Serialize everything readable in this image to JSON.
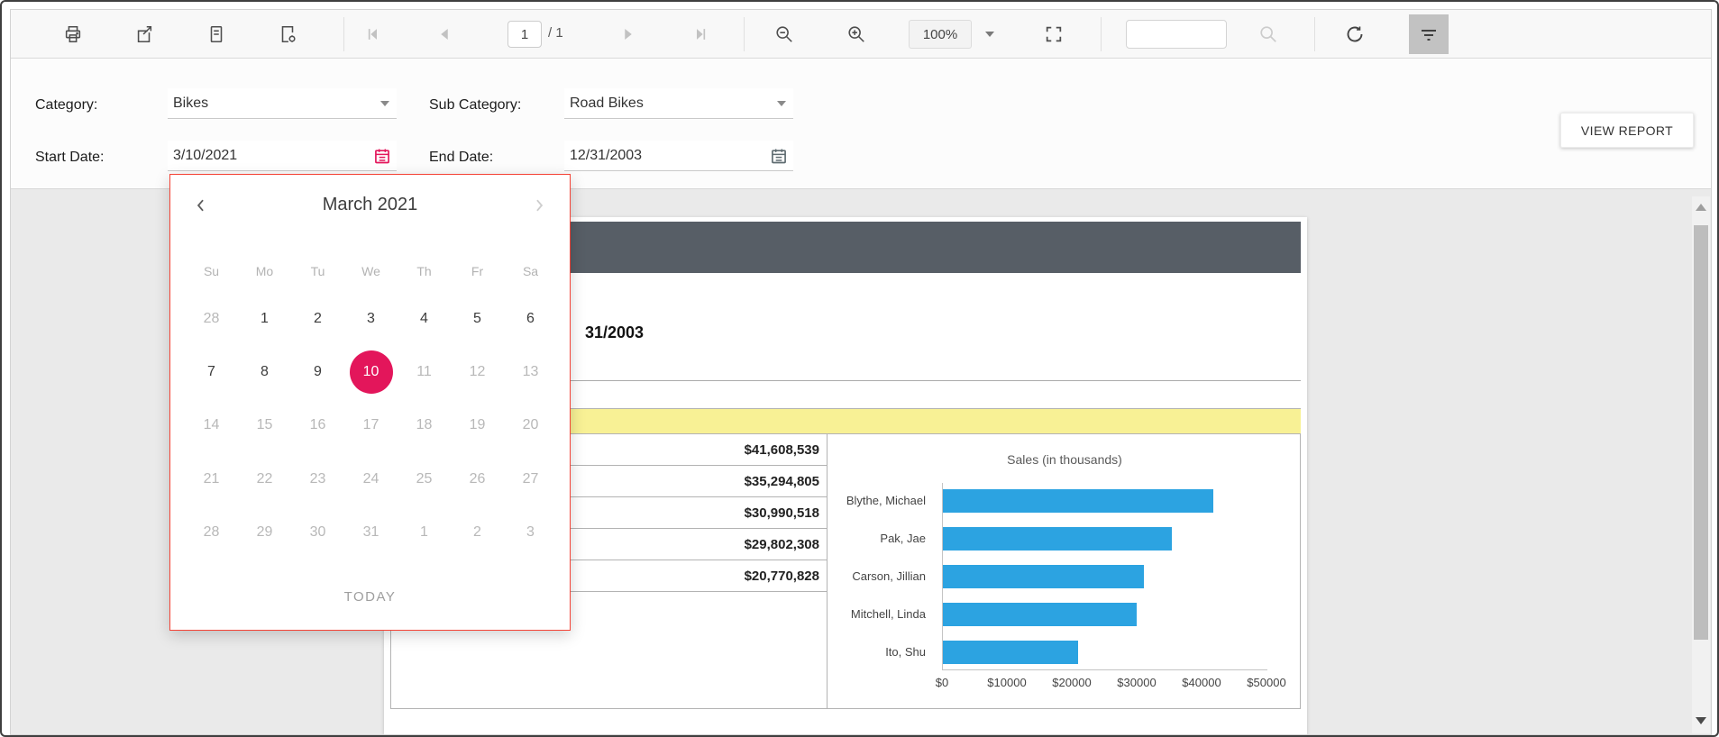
{
  "colors": {
    "accent_pink": "#e3165b",
    "popup_border": "#f44336",
    "bar_blue": "#2ca3e1",
    "header_slate": "#575e66",
    "table_header_yellow": "#f8f195"
  },
  "toolbar": {
    "page_number": "1",
    "page_count_display": "/ 1",
    "zoom_level": "100%",
    "search_value": ""
  },
  "parameters": {
    "category_label": "Category:",
    "category_value": "Bikes",
    "subcategory_label": "Sub Category:",
    "subcategory_value": "Road Bikes",
    "start_date_label": "Start Date:",
    "start_date_value": "3/10/2021",
    "end_date_label": "End Date:",
    "end_date_value": "12/31/2003",
    "view_report_label": "VIEW REPORT"
  },
  "datepicker": {
    "title": "March 2021",
    "day_headers": [
      "Su",
      "Mo",
      "Tu",
      "We",
      "Th",
      "Fr",
      "Sa"
    ],
    "weeks": [
      [
        {
          "d": "28",
          "muted": true
        },
        {
          "d": "1"
        },
        {
          "d": "2"
        },
        {
          "d": "3"
        },
        {
          "d": "4"
        },
        {
          "d": "5"
        },
        {
          "d": "6"
        }
      ],
      [
        {
          "d": "7"
        },
        {
          "d": "8"
        },
        {
          "d": "9"
        },
        {
          "d": "10",
          "selected": true
        },
        {
          "d": "11",
          "muted": true
        },
        {
          "d": "12",
          "muted": true
        },
        {
          "d": "13",
          "muted": true
        }
      ],
      [
        {
          "d": "14",
          "muted": true
        },
        {
          "d": "15",
          "muted": true
        },
        {
          "d": "16",
          "muted": true
        },
        {
          "d": "17",
          "muted": true
        },
        {
          "d": "18",
          "muted": true
        },
        {
          "d": "19",
          "muted": true
        },
        {
          "d": "20",
          "muted": true
        }
      ],
      [
        {
          "d": "21",
          "muted": true
        },
        {
          "d": "22",
          "muted": true
        },
        {
          "d": "23",
          "muted": true
        },
        {
          "d": "24",
          "muted": true
        },
        {
          "d": "25",
          "muted": true
        },
        {
          "d": "26",
          "muted": true
        },
        {
          "d": "27",
          "muted": true
        }
      ],
      [
        {
          "d": "28",
          "muted": true
        },
        {
          "d": "29",
          "muted": true
        },
        {
          "d": "30",
          "muted": true
        },
        {
          "d": "31",
          "muted": true
        },
        {
          "d": "1",
          "muted": true
        },
        {
          "d": "2",
          "muted": true
        },
        {
          "d": "3",
          "muted": true
        }
      ]
    ],
    "today_label": "TODAY"
  },
  "report": {
    "heading_visible_text": "31/2003",
    "table_values": [
      "$41,608,539",
      "$35,294,805",
      "$30,990,518",
      "$29,802,308",
      "$20,770,828"
    ]
  },
  "chart_data": {
    "type": "bar",
    "orientation": "horizontal",
    "title": "Sales (in thousands)",
    "categories": [
      "Blythe, Michael",
      "Pak, Jae",
      "Carson, Jillian",
      "Mitchell, Linda",
      "Ito, Shu"
    ],
    "values": [
      41608,
      35295,
      30991,
      29802,
      20771
    ],
    "xticks": [
      "$0",
      "$10000",
      "$20000",
      "$30000",
      "$40000",
      "$50000"
    ],
    "xtick_values": [
      0,
      10000,
      20000,
      30000,
      40000,
      50000
    ],
    "xlim": [
      0,
      50000
    ],
    "bar_color": "#2ca3e1",
    "grid": false,
    "legend": false
  }
}
